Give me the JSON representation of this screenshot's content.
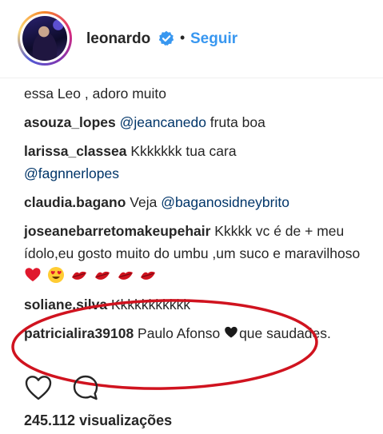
{
  "header": {
    "username": "leonardo",
    "separator": "•",
    "follow_label": "Seguir"
  },
  "comments": [
    {
      "user": "",
      "text": "essa Leo , adoro muito"
    },
    {
      "user": "asouza_lopes",
      "mention": "@jeancanedo",
      "text": " fruta boa"
    },
    {
      "user": "larissa_classea",
      "text": " Kkkkkkk tua cara",
      "mention_after": "@fagnnerlopes"
    },
    {
      "user": "claudia.bagano",
      "text": " Veja ",
      "mention_after": "@baganosidneybrito"
    },
    {
      "user": "joseanebarretomakeupehair",
      "text": " Kkkkk vc é de + meu ídolo,eu gosto muito do umbu ,um suco e maravilhoso"
    },
    {
      "user": "soliane.silva",
      "text": " Kkkkkkkkkkk"
    },
    {
      "user": "patricialira39108",
      "text_before": " Paulo Afonso ",
      "text_after": "que saudades."
    }
  ],
  "icons": {
    "like": "heart-icon",
    "comment": "comment-bubble-icon",
    "verified": "verified-badge-icon"
  },
  "footer": {
    "views": "245.112 visualizações"
  },
  "colors": {
    "link": "#3897f0",
    "mention": "#003569",
    "highlight_oval": "#d0131f"
  }
}
